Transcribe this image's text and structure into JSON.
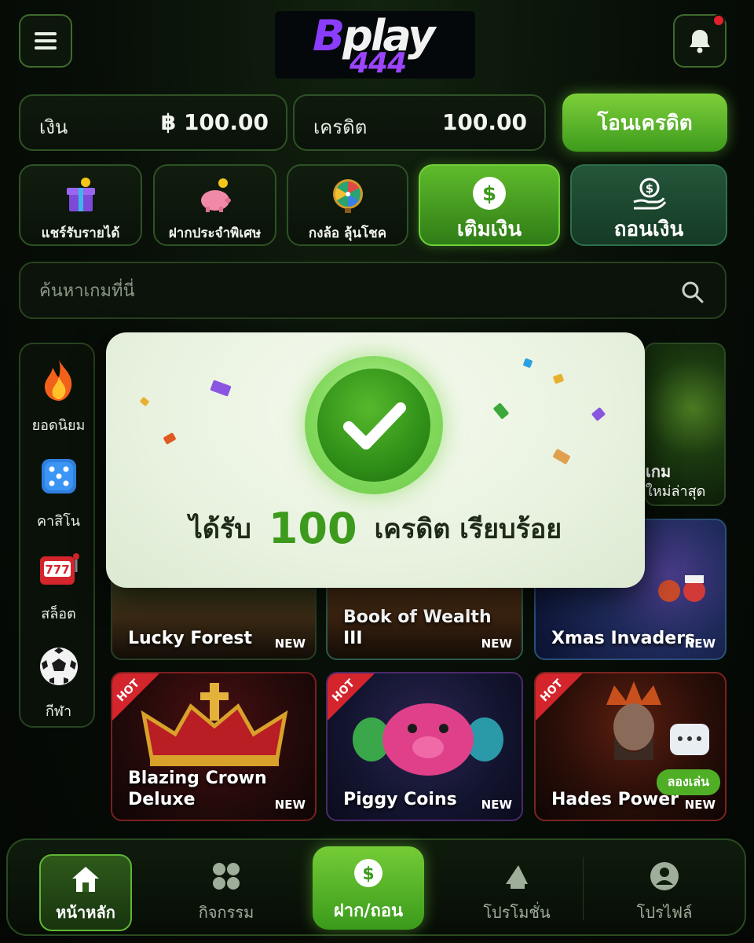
{
  "header": {
    "logo_main": "play",
    "logo_initial": "B",
    "logo_sub": "444"
  },
  "balance": {
    "cash_label": "เงิน",
    "cash_value": "฿ 100.00",
    "credit_label": "เครดิต",
    "credit_value": "100.00",
    "transfer_label": "โอนเครดิต"
  },
  "quick_actions": {
    "share": "แชร์รับรายได้",
    "deposit_special": "ฝากประจำพิเศษ",
    "wheel": "กงล้อ ลุ้นโชค",
    "topup": "เติมเงิน",
    "withdraw": "ถอนเงิน"
  },
  "search": {
    "placeholder": "ค้นหาเกมที่นี่"
  },
  "categories": [
    {
      "label": "ยอดนิยม",
      "icon": "fire-icon"
    },
    {
      "label": "คาสิโน",
      "icon": "dice-icon"
    },
    {
      "label": "สล็อต",
      "icon": "slot-machine-icon"
    },
    {
      "label": "กีฬา",
      "icon": "soccer-ball-icon"
    }
  ],
  "new_games_partial": {
    "line1": "เกม",
    "line2": "ใหม่ล่าสุด"
  },
  "games": [
    {
      "name": "Lucky Forest",
      "badge": "NEW"
    },
    {
      "name": "Book of Wealth III",
      "badge": "NEW"
    },
    {
      "name": "Xmas Invaders",
      "badge": "NEW"
    },
    {
      "name": "Blazing Crown Deluxe",
      "badge": "NEW",
      "ribbon": "HOT"
    },
    {
      "name": "Piggy Coins",
      "badge": "NEW",
      "ribbon": "HOT"
    },
    {
      "name": "Hades Power",
      "badge": "NEW",
      "ribbon": "HOT",
      "demo": "ลองเล่น"
    }
  ],
  "modal": {
    "prefix": "ได้รับ",
    "amount": "100",
    "suffix": "เครดิต เรียบร้อย"
  },
  "bottom_nav": {
    "home": "หน้าหลัก",
    "activities": "กิจกรรม",
    "wallet": "ฝาก/ถอน",
    "promotions": "โปรโมชั่น",
    "profile": "โปรไฟล์"
  },
  "colors": {
    "accent_green": "#5fbb2b",
    "brand_purple": "#8a3dff",
    "hot_red": "#d4252d",
    "notification_red": "#e0202a"
  }
}
